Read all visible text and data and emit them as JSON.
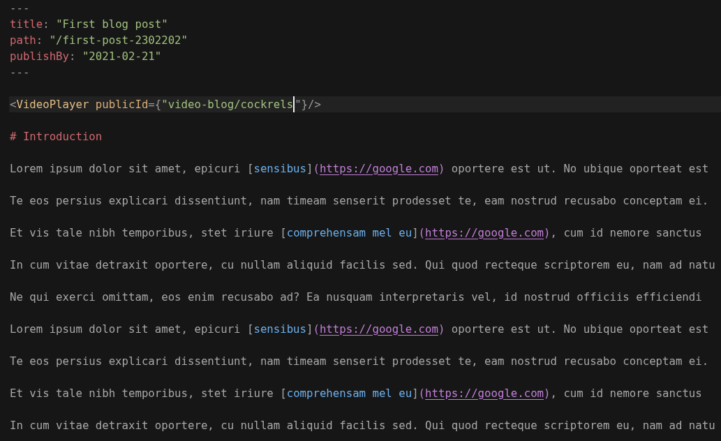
{
  "editor": {
    "lines": [
      {
        "current": false,
        "tokens": [
          {
            "kind": "punct",
            "text": "---"
          }
        ]
      },
      {
        "current": false,
        "tokens": [
          {
            "kind": "key",
            "text": "title"
          },
          {
            "kind": "punct",
            "text": ": "
          },
          {
            "kind": "string",
            "text": "\"First blog post\""
          }
        ]
      },
      {
        "current": false,
        "tokens": [
          {
            "kind": "key",
            "text": "path"
          },
          {
            "kind": "punct",
            "text": ": "
          },
          {
            "kind": "string",
            "text": "\"/first-post-2302202\""
          }
        ]
      },
      {
        "current": false,
        "tokens": [
          {
            "kind": "key",
            "text": "publishBy"
          },
          {
            "kind": "punct",
            "text": ": "
          },
          {
            "kind": "string",
            "text": "\"2021-02-21\""
          }
        ]
      },
      {
        "current": false,
        "tokens": [
          {
            "kind": "punct",
            "text": "---"
          }
        ]
      },
      {
        "current": false
      },
      {
        "current": true,
        "tokens": [
          {
            "kind": "punct",
            "text": "<"
          },
          {
            "kind": "tag",
            "text": "VideoPlayer "
          },
          {
            "kind": "attr",
            "text": "publicId"
          },
          {
            "kind": "punct",
            "text": "={"
          },
          {
            "kind": "string",
            "text": "\"video-blog/cockrels"
          },
          {
            "kind": "cursor"
          },
          {
            "kind": "punct",
            "text": "\"}/>"
          }
        ]
      },
      {
        "current": false
      },
      {
        "current": false,
        "tokens": [
          {
            "kind": "heading",
            "text": "# Introduction"
          }
        ]
      },
      {
        "current": false
      },
      {
        "current": false,
        "tokens": [
          {
            "kind": "text",
            "text": "Lorem ipsum dolor sit amet, epicuri ["
          },
          {
            "kind": "link_text",
            "text": "sensibus"
          },
          {
            "kind": "text",
            "text": "]"
          },
          {
            "kind": "link_paren",
            "text": "("
          },
          {
            "kind": "url",
            "text": "https://google.com"
          },
          {
            "kind": "link_paren",
            "text": ")"
          },
          {
            "kind": "text",
            "text": " oportere est ut. No ubique oporteat est"
          }
        ]
      },
      {
        "current": false
      },
      {
        "current": false,
        "tokens": [
          {
            "kind": "text",
            "text": "Te eos persius explicari dissentiunt, nam timeam senserit prodesset te, eam nostrud recusabo conceptam ei."
          }
        ]
      },
      {
        "current": false
      },
      {
        "current": false,
        "tokens": [
          {
            "kind": "text",
            "text": "Et vis tale nibh temporibus, stet iriure ["
          },
          {
            "kind": "link_text",
            "text": "comprehensam mel eu"
          },
          {
            "kind": "text",
            "text": "]"
          },
          {
            "kind": "link_paren",
            "text": "("
          },
          {
            "kind": "url",
            "text": "https://google.com"
          },
          {
            "kind": "link_paren",
            "text": ")"
          },
          {
            "kind": "text",
            "text": ", cum id nemore sanctus"
          }
        ]
      },
      {
        "current": false
      },
      {
        "current": false,
        "tokens": [
          {
            "kind": "text",
            "text": "In cum vitae detraxit oportere, cu nullam aliquid facilis sed. Qui quod recteque scriptorem eu, nam ad natu"
          }
        ]
      },
      {
        "current": false
      },
      {
        "current": false,
        "tokens": [
          {
            "kind": "text",
            "text": "Ne qui exerci omittam, eos enim recusabo ad? Ea nusquam interpretaris vel, id nostrud officiis efficiendi"
          }
        ]
      },
      {
        "current": false
      },
      {
        "current": false,
        "tokens": [
          {
            "kind": "text",
            "text": "Lorem ipsum dolor sit amet, epicuri ["
          },
          {
            "kind": "link_text",
            "text": "sensibus"
          },
          {
            "kind": "text",
            "text": "]"
          },
          {
            "kind": "link_paren",
            "text": "("
          },
          {
            "kind": "url",
            "text": "https://google.com"
          },
          {
            "kind": "link_paren",
            "text": ")"
          },
          {
            "kind": "text",
            "text": " oportere est ut. No ubique oporteat est"
          }
        ]
      },
      {
        "current": false
      },
      {
        "current": false,
        "tokens": [
          {
            "kind": "text",
            "text": "Te eos persius explicari dissentiunt, nam timeam senserit prodesset te, eam nostrud recusabo conceptam ei."
          }
        ]
      },
      {
        "current": false
      },
      {
        "current": false,
        "tokens": [
          {
            "kind": "text",
            "text": "Et vis tale nibh temporibus, stet iriure ["
          },
          {
            "kind": "link_text",
            "text": "comprehensam mel eu"
          },
          {
            "kind": "text",
            "text": "]"
          },
          {
            "kind": "link_paren",
            "text": "("
          },
          {
            "kind": "url",
            "text": "https://google.com"
          },
          {
            "kind": "link_paren",
            "text": ")"
          },
          {
            "kind": "text",
            "text": ", cum id nemore sanctus"
          }
        ]
      },
      {
        "current": false
      },
      {
        "current": false,
        "tokens": [
          {
            "kind": "text",
            "text": "In cum vitae detraxit oportere, cu nullam aliquid facilis sed. Qui quod recteque scriptorem eu, nam ad natu"
          }
        ]
      }
    ]
  }
}
